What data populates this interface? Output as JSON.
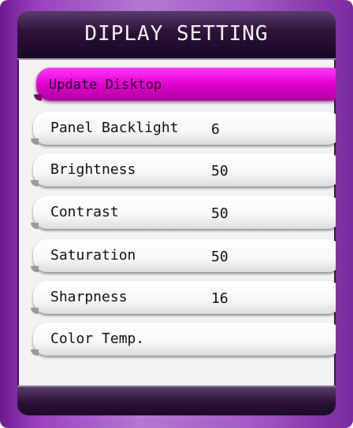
{
  "window": {
    "title": "DIPLAY SETTING"
  },
  "menu": {
    "items": [
      {
        "label": "Update Disktop",
        "value": ""
      },
      {
        "label": "Panel Backlight",
        "value": "6"
      },
      {
        "label": "Brightness",
        "value": "50"
      },
      {
        "label": "Contrast",
        "value": "50"
      },
      {
        "label": "Saturation",
        "value": "50"
      },
      {
        "label": "Sharpness",
        "value": "16"
      },
      {
        "label": "Color Temp.",
        "value": ""
      }
    ],
    "selected_index": 0
  },
  "colors": {
    "frame": "#9a3fbf",
    "title_bar": "#2c1238",
    "selected_item": "#e000d0",
    "item": "#ffffff",
    "background": "#f2f2f2"
  }
}
